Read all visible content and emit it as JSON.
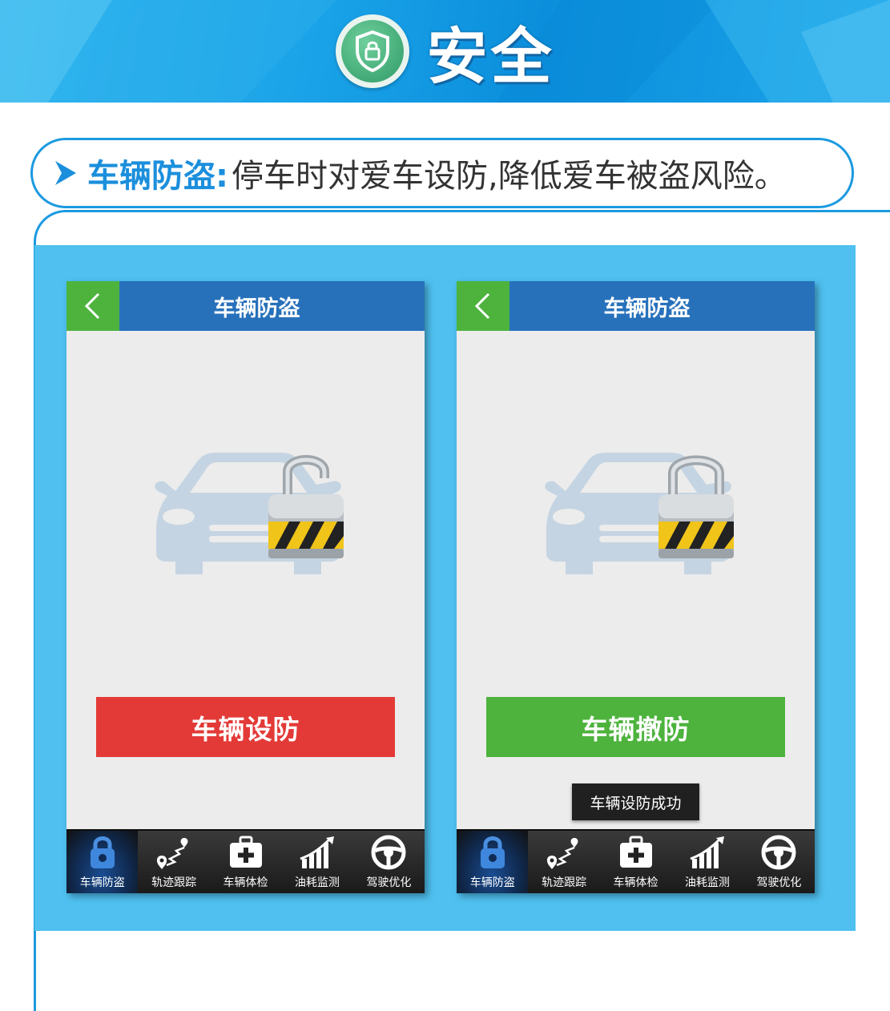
{
  "banner": {
    "title": "安全",
    "icon": "shield-lock-icon",
    "colors": {
      "gradient_start": "#33b7ef",
      "gradient_end": "#0b8fdc"
    }
  },
  "subtitle": {
    "key": "车辆防盗:",
    "description": "停车时对爱车设防,降低爱车被盗风险。",
    "accent_color": "#1b8fdc"
  },
  "screens": [
    {
      "title": "车辆防盗",
      "back_icon": "chevron-left-icon",
      "lock_state": "unlocked",
      "action_label": "车辆设防",
      "action_color": "#e33a37",
      "toast": ""
    },
    {
      "title": "车辆防盗",
      "back_icon": "chevron-left-icon",
      "lock_state": "locked",
      "action_label": "车辆撤防",
      "action_color": "#4db33d",
      "toast": "车辆设防成功"
    }
  ],
  "tabbar": {
    "items": [
      {
        "label": "车辆防盗",
        "icon": "padlock-icon",
        "active": true
      },
      {
        "label": "轨迹跟踪",
        "icon": "route-pin-icon",
        "active": false
      },
      {
        "label": "车辆体检",
        "icon": "first-aid-kit-icon",
        "active": false
      },
      {
        "label": "油耗监测",
        "icon": "rising-chart-icon",
        "active": false
      },
      {
        "label": "驾驶优化",
        "icon": "steering-wheel-icon",
        "active": false
      }
    ]
  }
}
